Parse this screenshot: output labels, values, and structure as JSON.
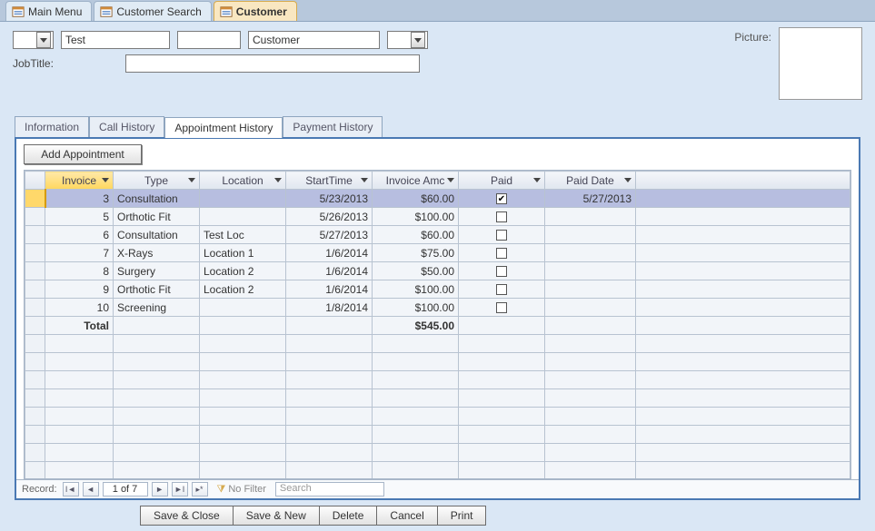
{
  "window_tabs": [
    {
      "label": "Main Menu",
      "active": false
    },
    {
      "label": "Customer Search",
      "active": false
    },
    {
      "label": "Customer",
      "active": true
    }
  ],
  "header": {
    "first": "Test",
    "mid": "",
    "last": "Customer",
    "jobtitle_label": "JobTitle:",
    "jobtitle_value": "",
    "picture_label": "Picture:"
  },
  "inner_tabs": [
    {
      "label": "Information"
    },
    {
      "label": "Call History"
    },
    {
      "label": "Appointment History",
      "active": true
    },
    {
      "label": "Payment History"
    }
  ],
  "add_button": "Add Appointment",
  "columns": [
    "Invoice",
    "Type",
    "Location",
    "StartTime",
    "Invoice Amc",
    "Paid",
    "Paid Date"
  ],
  "rows": [
    {
      "invoice": "3",
      "type": "Consultation",
      "location": "",
      "start": "5/23/2013",
      "amt": "$60.00",
      "paid": true,
      "paiddate": "5/27/2013",
      "selected": true
    },
    {
      "invoice": "5",
      "type": "Orthotic Fit",
      "location": "",
      "start": "5/26/2013",
      "amt": "$100.00",
      "paid": false,
      "paiddate": ""
    },
    {
      "invoice": "6",
      "type": "Consultation",
      "location": "Test Loc",
      "start": "5/27/2013",
      "amt": "$60.00",
      "paid": false,
      "paiddate": ""
    },
    {
      "invoice": "7",
      "type": "X-Rays",
      "location": "Location 1",
      "start": "1/6/2014",
      "amt": "$75.00",
      "paid": false,
      "paiddate": ""
    },
    {
      "invoice": "8",
      "type": "Surgery",
      "location": "Location 2",
      "start": "1/6/2014",
      "amt": "$50.00",
      "paid": false,
      "paiddate": ""
    },
    {
      "invoice": "9",
      "type": "Orthotic Fit",
      "location": "Location 2",
      "start": "1/6/2014",
      "amt": "$100.00",
      "paid": false,
      "paiddate": ""
    },
    {
      "invoice": "10",
      "type": "Screening",
      "location": "",
      "start": "1/8/2014",
      "amt": "$100.00",
      "paid": false,
      "paiddate": ""
    }
  ],
  "total": {
    "label": "Total",
    "amt": "$545.00"
  },
  "recnav": {
    "label": "Record:",
    "pos": "1 of 7",
    "nofilter": "No Filter",
    "search": "Search"
  },
  "buttons": {
    "saveclose": "Save & Close",
    "savenew": "Save & New",
    "delete": "Delete",
    "cancel": "Cancel",
    "print": "Print"
  }
}
